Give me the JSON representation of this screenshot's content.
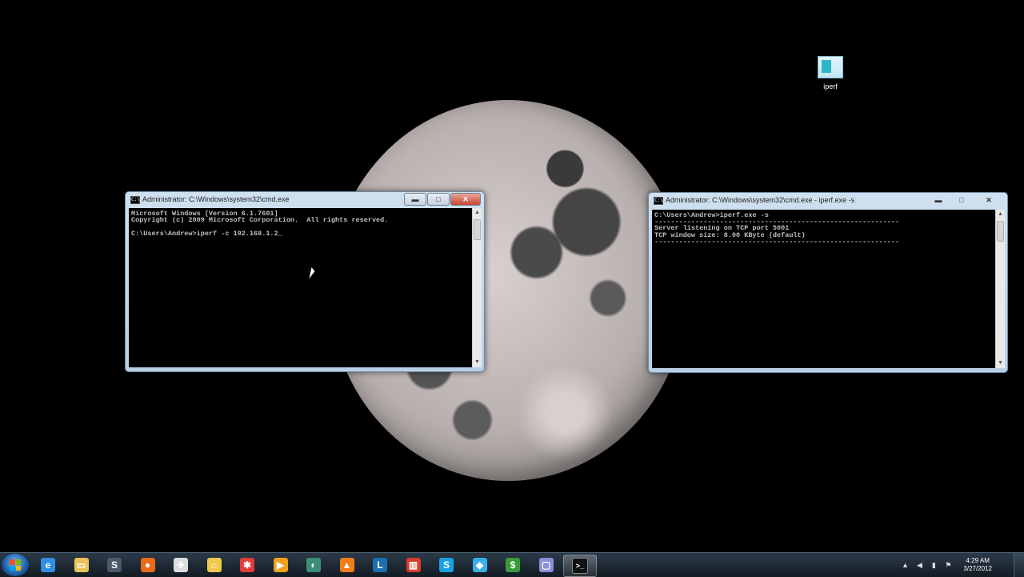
{
  "desktop": {
    "icons": [
      {
        "label": "iperf"
      }
    ]
  },
  "windows": {
    "client": {
      "title": "Administrator: C:\\Windows\\system32\\cmd.exe",
      "lines": "Microsoft Windows [Version 6.1.7601]\nCopyright (c) 2009 Microsoft Corporation.  All rights reserved.\n\nC:\\Users\\Andrew>iperf -c 192.168.1.2_"
    },
    "server": {
      "title": "Administrator: C:\\Windows\\system32\\cmd.exe - iperf.exe  -s",
      "lines": "C:\\Users\\Andrew>iperf.exe -s\n------------------------------------------------------------\nServer listening on TCP port 5001\nTCP window size: 8.00 KByte (default)\n------------------------------------------------------------"
    },
    "controls": {
      "minimize": "▬",
      "maximize": "□",
      "close": "✕"
    }
  },
  "taskbar": {
    "pinned": [
      {
        "name": "ie-icon",
        "glyph": "e",
        "color": "#2f8fe6"
      },
      {
        "name": "explorer-icon",
        "glyph": "▭",
        "color": "#e8c35a"
      },
      {
        "name": "steam-icon",
        "glyph": "S",
        "color": "#4a5a6a"
      },
      {
        "name": "firefox-icon",
        "glyph": "●",
        "color": "#e86a1a"
      },
      {
        "name": "tool-icon",
        "glyph": "✈",
        "color": "#dddddd"
      },
      {
        "name": "home-icon",
        "glyph": "⌂",
        "color": "#f1c94c"
      },
      {
        "name": "pinwheel-icon",
        "glyph": "✱",
        "color": "#e23b3b"
      },
      {
        "name": "media-icon",
        "glyph": "▶",
        "color": "#f0a020"
      },
      {
        "name": "audio-icon",
        "glyph": "◐",
        "color": "#3c8c78"
      },
      {
        "name": "vlc-icon",
        "glyph": "▲",
        "color": "#f07d1a"
      },
      {
        "name": "l-app-icon",
        "glyph": "L",
        "color": "#1e6fb0"
      },
      {
        "name": "redgreen-icon",
        "glyph": "▥",
        "color": "#d63b2b"
      },
      {
        "name": "skype-icon",
        "glyph": "S",
        "color": "#1aa2e0"
      },
      {
        "name": "box-icon",
        "glyph": "◆",
        "color": "#3ab0e8"
      },
      {
        "name": "money-icon",
        "glyph": "$",
        "color": "#3b9b3b"
      },
      {
        "name": "app-icon",
        "glyph": "▢",
        "color": "#8a8fd8"
      },
      {
        "name": "cmd-icon",
        "glyph": ">_",
        "color": "#111111"
      }
    ],
    "tray": {
      "chevron": "▲",
      "speaker": "◀",
      "network": "▮",
      "flag": "⚑",
      "clock_time": "4:29 AM",
      "clock_date": "3/27/2012"
    }
  }
}
